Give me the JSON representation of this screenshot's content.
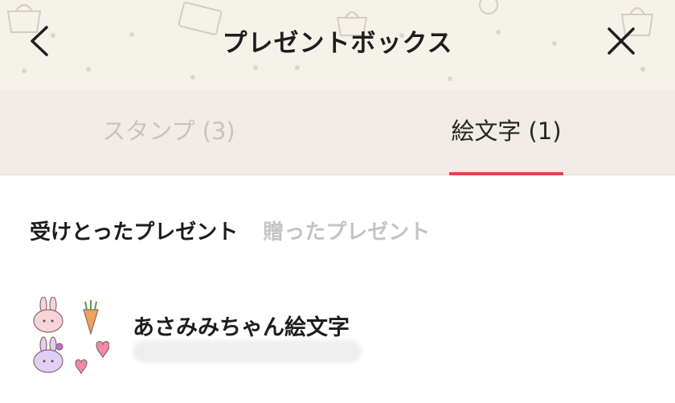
{
  "header": {
    "title": "プレゼントボックス",
    "back_icon": "chevron-left-icon",
    "close_icon": "close-icon"
  },
  "tabs": [
    {
      "label": "スタンプ (3)",
      "active": false
    },
    {
      "label": "絵文字 (1)",
      "active": true
    }
  ],
  "subtabs": [
    {
      "label": "受けとったプレゼント",
      "active": true
    },
    {
      "label": "贈ったプレゼント",
      "active": false
    }
  ],
  "items": [
    {
      "name": "あさみみちゃん絵文字",
      "subtitle": "",
      "thumbnail_icon": "emoji-pack-icon"
    }
  ],
  "colors": {
    "header_bg": "#f5f2ea",
    "tab_bar_bg": "#f1ece5",
    "accent": "#e14550",
    "inactive_text": "#c4c4c4"
  }
}
